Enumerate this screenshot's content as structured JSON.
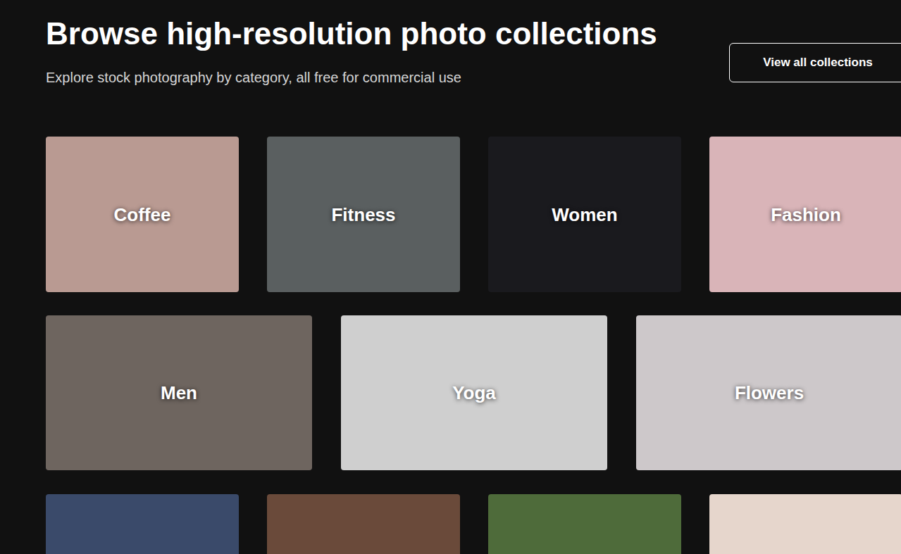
{
  "page": {
    "title": "Browse high-resolution photo collections",
    "subtitle": "Explore stock photography by category, all free for commercial use"
  },
  "view_all_button": {
    "label": "View all collections"
  },
  "rows": [
    {
      "cards": [
        {
          "label": "Coffee"
        },
        {
          "label": "Fitness"
        },
        {
          "label": "Women"
        },
        {
          "label": "Fashion"
        }
      ]
    },
    {
      "cards": [
        {
          "label": "Men"
        },
        {
          "label": "Yoga"
        },
        {
          "label": "Flowers"
        }
      ]
    },
    {
      "cards": [
        {},
        {},
        {},
        {}
      ]
    }
  ]
}
